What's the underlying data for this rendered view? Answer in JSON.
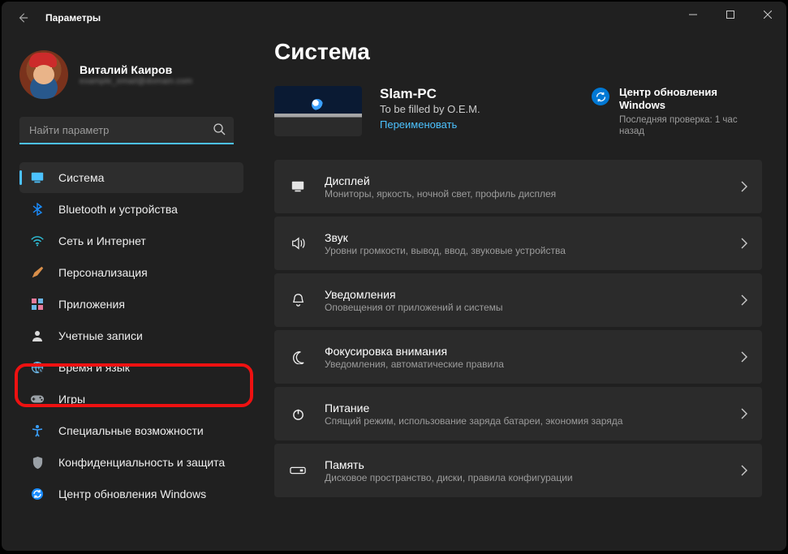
{
  "window": {
    "title": "Параметры"
  },
  "user": {
    "name": "Виталий Каиров",
    "sub": "example_email@domain.com"
  },
  "search": {
    "placeholder": "Найти параметр"
  },
  "nav": [
    {
      "id": "system",
      "label": "Система",
      "icon": "monitor",
      "color": "#4cc2ff",
      "selected": true
    },
    {
      "id": "bluetooth",
      "label": "Bluetooth и устройства",
      "icon": "bluetooth",
      "color": "#1a8cff"
    },
    {
      "id": "network",
      "label": "Сеть и Интернет",
      "icon": "wifi",
      "color": "#2ec0d9"
    },
    {
      "id": "personalize",
      "label": "Персонализация",
      "icon": "brush",
      "color": "#d98f4a"
    },
    {
      "id": "apps",
      "label": "Приложения",
      "icon": "apps",
      "color": "#e67a9b"
    },
    {
      "id": "accounts",
      "label": "Учетные записи",
      "icon": "person",
      "color": "#d9d9d9"
    },
    {
      "id": "time",
      "label": "Время и язык",
      "icon": "globe",
      "color": "#6bb6e6",
      "highlighted": true
    },
    {
      "id": "gaming",
      "label": "Игры",
      "icon": "gamepad",
      "color": "#9aa0a6"
    },
    {
      "id": "accessibility",
      "label": "Специальные возможности",
      "icon": "access",
      "color": "#3aa0ff"
    },
    {
      "id": "privacy",
      "label": "Конфиденциальность и защита",
      "icon": "shield",
      "color": "#9aa0a6"
    },
    {
      "id": "update",
      "label": "Центр обновления Windows",
      "icon": "sync",
      "color": "#1a8cff"
    }
  ],
  "page": {
    "title": "Система",
    "device": {
      "name": "Slam-PC",
      "sub": "To be filled by O.E.M.",
      "rename": "Переименовать"
    },
    "update": {
      "title": "Центр обновления Windows",
      "sub": "Последняя проверка: 1 час назад"
    },
    "cards": [
      {
        "id": "display",
        "icon": "monitor",
        "title": "Дисплей",
        "sub": "Мониторы, яркость, ночной свет, профиль дисплея"
      },
      {
        "id": "sound",
        "icon": "sound",
        "title": "Звук",
        "sub": "Уровни громкости, вывод, ввод, звуковые устройства"
      },
      {
        "id": "notif",
        "icon": "bell",
        "title": "Уведомления",
        "sub": "Оповещения от приложений и системы"
      },
      {
        "id": "focus",
        "icon": "moon",
        "title": "Фокусировка внимания",
        "sub": "Уведомления, автоматические правила"
      },
      {
        "id": "power",
        "icon": "power",
        "title": "Питание",
        "sub": "Спящий режим, использование заряда батареи, экономия заряда"
      },
      {
        "id": "storage",
        "icon": "storage",
        "title": "Память",
        "sub": "Дисковое пространство, диски, правила конфигурации"
      }
    ]
  }
}
